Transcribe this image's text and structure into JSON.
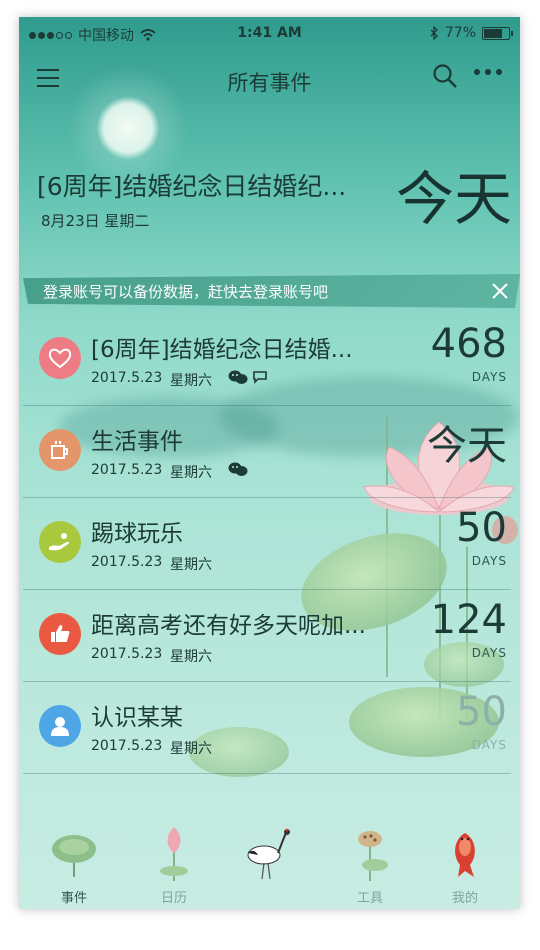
{
  "status_bar": {
    "carrier": "中国移动",
    "time": "1:41 AM",
    "battery": "77%"
  },
  "nav": {
    "title": "所有事件"
  },
  "header": {
    "title": "[6周年]结婚纪念日结婚纪...",
    "date": "8月23日 星期二",
    "count": "今天"
  },
  "banner": {
    "text": "登录账号可以备份数据，赶快去登录账号吧"
  },
  "events": [
    {
      "title": "[6周年]结婚纪念日结婚...",
      "date": "2017.5.23",
      "weekday": "星期六",
      "count": "468",
      "unit": "DAYS",
      "icon": "heart-icon",
      "color": "#ee7c84",
      "social": [
        "wechat-icon",
        "chat-bubble-icon"
      ]
    },
    {
      "title": "生活事件",
      "date": "2017.5.23",
      "weekday": "星期六",
      "count": "今天",
      "unit": "",
      "icon": "mug-icon",
      "color": "#e4956a",
      "social": [
        "wechat-icon"
      ]
    },
    {
      "title": "踢球玩乐",
      "date": "2017.5.23",
      "weekday": "星期六",
      "count": "50",
      "unit": "DAYS",
      "icon": "play-hand-icon",
      "color": "#a8c93d",
      "social": []
    },
    {
      "title": "距离高考还有好多天呢加...",
      "date": "2017.5.23",
      "weekday": "星期六",
      "count": "124",
      "unit": "DAYS",
      "icon": "thumbs-up-icon",
      "color": "#ea5a43",
      "social": []
    },
    {
      "title": "认识某某",
      "date": "2017.5.23",
      "weekday": "星期六",
      "count": "50",
      "unit": "DAYS",
      "icon": "person-icon",
      "color": "#4fa6e6",
      "social": []
    }
  ],
  "tabs": [
    {
      "label": "事件",
      "icon": "lotus-leaf-icon",
      "active": true
    },
    {
      "label": "日历",
      "icon": "lotus-bud-icon",
      "active": false
    },
    {
      "label": "",
      "icon": "crane-icon",
      "active": false
    },
    {
      "label": "工具",
      "icon": "lotus-pod-icon",
      "active": false
    },
    {
      "label": "我的",
      "icon": "koi-fish-icon",
      "active": false
    }
  ]
}
